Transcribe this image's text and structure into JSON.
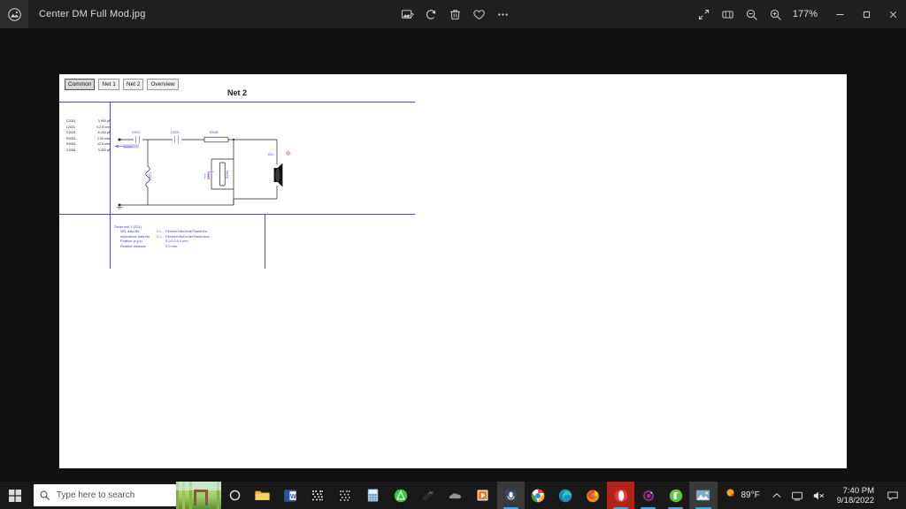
{
  "window": {
    "app_icon": "photo-icon",
    "title": "Center DM Full Mod.jpg",
    "zoom_level": "177%",
    "center_tools": [
      {
        "name": "edit-image-icon",
        "label": "Edit image"
      },
      {
        "name": "rotate-icon",
        "label": "Rotate"
      },
      {
        "name": "delete-icon",
        "label": "Delete"
      },
      {
        "name": "favorite-heart-icon",
        "label": "Add to favorites"
      },
      {
        "name": "more-options-icon",
        "label": "See more"
      }
    ],
    "view_tools": [
      {
        "name": "fullscreen-icon",
        "label": "Fullscreen"
      },
      {
        "name": "fit-to-window-icon",
        "label": "Fit to window"
      },
      {
        "name": "zoom-out-icon",
        "label": "Zoom out"
      },
      {
        "name": "zoom-in-icon",
        "label": "Zoom in"
      }
    ],
    "caption_buttons": [
      {
        "name": "minimize-button",
        "glyph": "─"
      },
      {
        "name": "maximize-button",
        "glyph": "❐"
      },
      {
        "name": "close-button",
        "glyph": "✕"
      }
    ]
  },
  "schematic": {
    "tabs": [
      {
        "label": "Common",
        "active": true
      },
      {
        "label": "Net 1",
        "active": false
      },
      {
        "label": "Net 2",
        "active": false
      },
      {
        "label": "Overview",
        "active": false
      }
    ],
    "sheet_title": "Net 2",
    "component_list": [
      {
        "ref": "C2011",
        "value": "3.900 µF"
      },
      {
        "ref": "L2021",
        "value": "0.270 mH"
      },
      {
        "ref": "C2031",
        "value": "6.200 µF"
      },
      {
        "ref": "R2051",
        "value": "2.00 ohm"
      },
      {
        "ref": "R2061",
        "value": "12.5 ohm"
      },
      {
        "ref": "C2081",
        "value": "3.300 µF"
      }
    ],
    "source_label": "source",
    "component_labels": {
      "c2011": "C2011",
      "c2031": "C2031",
      "r2061_h": "R2081",
      "l2021": "L2021",
      "r2051": "R2051",
      "r2061_v": "R2061",
      "driver": "D21"
    },
    "info_block": {
      "heading": "Driver unit 1 (D21)",
      "rows": [
        {
          "label": "SPL data file",
          "prefix": "C:\\...",
          "value": "PioneerVifaCenterTweet.frd"
        },
        {
          "label": "Impedance data file",
          "prefix": "C:\\...",
          "value": "PioneerVifaCenterTweet.zma"
        },
        {
          "label": "Position (x,y,z)",
          "prefix": "",
          "value": "0.0;0.0;0.0 mm"
        },
        {
          "label": "Relative distance",
          "prefix": "",
          "value": "0.0 mm"
        }
      ]
    },
    "colors": {
      "frame": "#4b4bd2",
      "text": "#3a3ad0",
      "wire": "#222222",
      "component_pink": "#d86ec0"
    }
  },
  "taskbar": {
    "start_label": "Start",
    "search_placeholder": "Type here to search",
    "search_icon": "search-icon",
    "search_thumbnail": "bamboo-garden-thumbnail",
    "cortana_icon": "cortana-circle-icon",
    "pinned": [
      {
        "name": "file-explorer-icon",
        "label": "File Explorer"
      },
      {
        "name": "word-icon",
        "label": "Word"
      },
      {
        "name": "qr-grid-app-icon",
        "label": "App"
      },
      {
        "name": "dark-grid-app-icon",
        "label": "App"
      },
      {
        "name": "calculator-icon",
        "label": "Calculator"
      },
      {
        "name": "acrobat-icon",
        "label": "Reader"
      },
      {
        "name": "video-editor-icon",
        "label": "Video Editor"
      },
      {
        "name": "cloud-app-icon",
        "label": "App"
      },
      {
        "name": "media-player-icon",
        "label": "Media Player"
      },
      {
        "name": "audio-app-icon",
        "label": "Audio app"
      },
      {
        "name": "chrome-icon",
        "label": "Google Chrome"
      },
      {
        "name": "edge-icon",
        "label": "Microsoft Edge"
      },
      {
        "name": "firefox-icon",
        "label": "Firefox"
      },
      {
        "name": "opera-icon",
        "label": "Opera"
      },
      {
        "name": "camera-app-icon",
        "label": "Camera app"
      },
      {
        "name": "utorrent-icon",
        "label": "uTorrent"
      },
      {
        "name": "photos-icon",
        "label": "Photos"
      }
    ],
    "weather": {
      "icon": "sun-icon",
      "temperature": "89°F"
    },
    "tray": [
      {
        "name": "show-hidden-icons-chevron",
        "glyph": "∧"
      },
      {
        "name": "network-icon",
        "glyph": "⎕"
      },
      {
        "name": "volume-muted-icon",
        "glyph": "⏷"
      }
    ],
    "clock": {
      "time": "7:40 PM",
      "date": "9/18/2022"
    },
    "notification_icon": "notification-icon"
  }
}
